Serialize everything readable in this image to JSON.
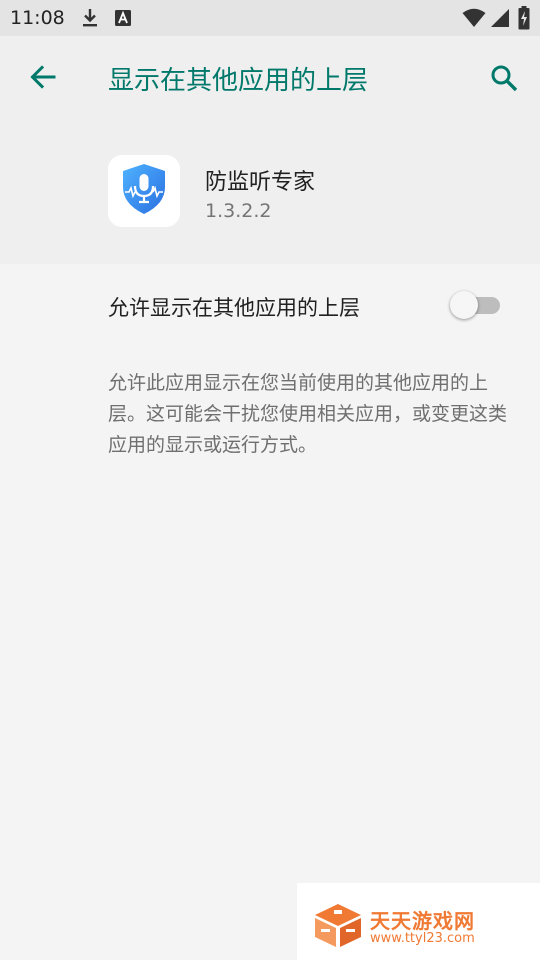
{
  "status_bar": {
    "time": "11:08",
    "icons": [
      "download-icon",
      "a-box-icon",
      "wifi-icon",
      "signal-icon",
      "battery-charging-icon"
    ]
  },
  "app_bar": {
    "title": "显示在其他应用的上层",
    "back_icon": "back-arrow-icon",
    "search_icon": "search-icon",
    "accent_color": "#00796b"
  },
  "app_info": {
    "name": "防监听专家",
    "version": "1.3.2.2",
    "icon": "shield-microphone-icon"
  },
  "setting": {
    "label": "允许显示在其他应用的上层",
    "enabled": false,
    "description": "允许此应用显示在您当前使用的其他应用的上层。这可能会干扰您使用相关应用，或变更这类应用的显示或运行方式。"
  },
  "watermark": {
    "name": "天天游戏网",
    "url": "www.ttyl23.com",
    "color": "#f07a34"
  }
}
